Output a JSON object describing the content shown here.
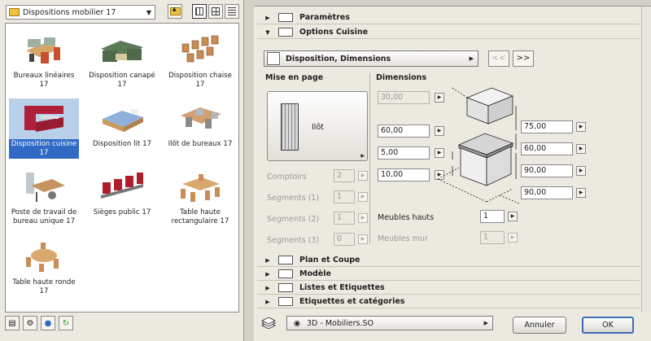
{
  "library": {
    "selected_folder": "Dispositions mobilier 17",
    "items": [
      {
        "label": "Bureaux linéaires 17"
      },
      {
        "label": "Disposition canapé 17"
      },
      {
        "label": "Disposition chaise 17"
      },
      {
        "label": "Disposition cuisine 17"
      },
      {
        "label": "Disposition lit 17"
      },
      {
        "label": "Ilôt de bureaux 17"
      },
      {
        "label": "Poste de travail de bureau unique 17"
      },
      {
        "label": "Sièges public 17"
      },
      {
        "label": "Table haute rectangulaire 17"
      },
      {
        "label": "Table haute ronde 17"
      }
    ]
  },
  "sections": {
    "parametres": "Paramètres",
    "options_cuisine": "Options Cuisine",
    "plan_coupe": "Plan et Coupe",
    "modele": "Modèle",
    "listes": "Listes et Etiquettes",
    "etiquettes": "Etiquettes et catégories"
  },
  "pane": {
    "dropdown": "Disposition, Dimensions",
    "nav_prev": "<<",
    "nav_next": ">>",
    "mise_en_page": "Mise en page",
    "dimensions": "Dimensions",
    "ilot_label": "Ilôt",
    "comptoirs_label": "Comptoirs",
    "comptoirs_value": "2",
    "segments1_label": "Segments (1)",
    "segments1_value": "1",
    "segments2_label": "Segments (2)",
    "segments2_value": "1",
    "segments3_label": "Segments (3)",
    "segments3_value": "0",
    "dim_top": "30,00",
    "dim_left1": "60,00",
    "dim_left2": "5,00",
    "dim_left3": "10,00",
    "dim_right1": "75,00",
    "dim_right2": "60,00",
    "dim_right3": "90,00",
    "dim_right4": "90,00",
    "meubles_hauts_label": "Meubles hauts",
    "meubles_hauts_value": "1",
    "meubles_mur_label": "Meubles mur",
    "meubles_mur_value": "1"
  },
  "footer": {
    "view_select": "3D - Mobiliers.SO",
    "cancel": "Annuler",
    "ok": "OK"
  },
  "colors": {
    "selection": "#316ac5",
    "panel_bg": "#ece9e0",
    "kitchen_red": "#b0203a"
  }
}
